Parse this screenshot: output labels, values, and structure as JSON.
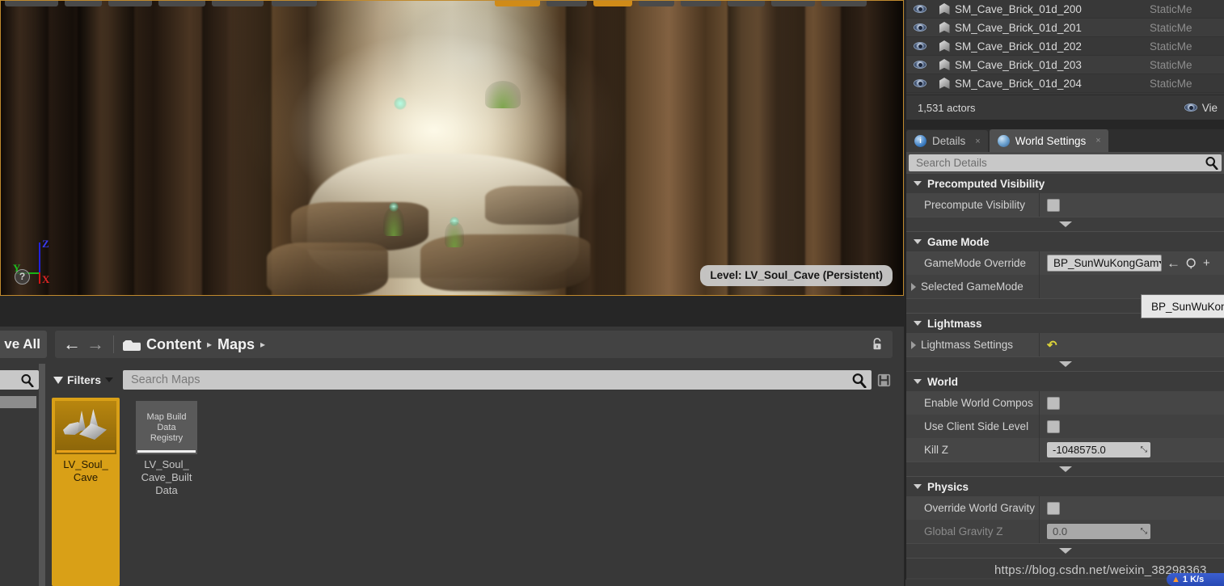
{
  "viewport": {
    "level_label": "Level:  LV_Soul_Cave (Persistent)",
    "axis": {
      "x": "X",
      "y": "Y",
      "z": "Z",
      "help": "?"
    }
  },
  "outliner": {
    "rows": [
      {
        "name": "SM_Cave_Brick_01d_200",
        "type": "StaticMe"
      },
      {
        "name": "SM_Cave_Brick_01d_201",
        "type": "StaticMe"
      },
      {
        "name": "SM_Cave_Brick_01d_202",
        "type": "StaticMe"
      },
      {
        "name": "SM_Cave_Brick_01d_203",
        "type": "StaticMe"
      },
      {
        "name": "SM_Cave_Brick_01d_204",
        "type": "StaticMe"
      }
    ],
    "actor_count": "1,531 actors",
    "view_options": "Vie"
  },
  "details": {
    "tabs": [
      {
        "label": "Details",
        "icon": "info-icon",
        "active": false,
        "close": "×"
      },
      {
        "label": "World Settings",
        "icon": "globe-icon",
        "active": true,
        "close": "×"
      }
    ],
    "search_placeholder": "Search Details",
    "categories": {
      "precomputed_visibility": {
        "title": "Precomputed Visibility",
        "rows": [
          {
            "label": "Precompute Visibility",
            "type": "checkbox",
            "checked": false
          }
        ]
      },
      "game_mode": {
        "title": "Game Mode",
        "override_label": "GameMode Override",
        "override_value": "BP_SunWuKongGam",
        "selected_label": "Selected GameMode",
        "tooltip": "BP_SunWuKon",
        "buttons": {
          "back": "←",
          "browse": "browse-icon",
          "add": "+"
        }
      },
      "lightmass": {
        "title": "Lightmass",
        "rows": [
          {
            "label": "Lightmass Settings",
            "type": "expandable",
            "revert": "revert-icon"
          }
        ]
      },
      "world": {
        "title": "World",
        "rows": [
          {
            "label": "Enable World Compos",
            "type": "checkbox",
            "checked": false
          },
          {
            "label": "Use Client Side Level",
            "type": "checkbox",
            "checked": false
          },
          {
            "label": "Kill Z",
            "type": "number",
            "value": "-1048575.0"
          }
        ]
      },
      "physics": {
        "title": "Physics",
        "rows": [
          {
            "label": "Override World Gravity",
            "type": "checkbox",
            "checked": false
          },
          {
            "label": "Global Gravity Z",
            "type": "number",
            "value": "0.0",
            "disabled": true
          }
        ]
      }
    }
  },
  "content_browser": {
    "save_all": "ve All",
    "breadcrumb": [
      "Content",
      "Maps"
    ],
    "crumb_sep": "▸",
    "filters_label": "Filters",
    "search_placeholder": "Search Maps",
    "assets": [
      {
        "name": "LV_Soul_\nCave",
        "kind": "level",
        "selected": true
      },
      {
        "name": "LV_Soul_\nCave_Built\nData",
        "kind": "data",
        "thumb_text": "Map Build\nData\nRegistry",
        "selected": false
      }
    ]
  },
  "overlay": {
    "watermark": "https://blog.csdn.net/weixin_38298363",
    "network_speed": "1 K/s"
  }
}
